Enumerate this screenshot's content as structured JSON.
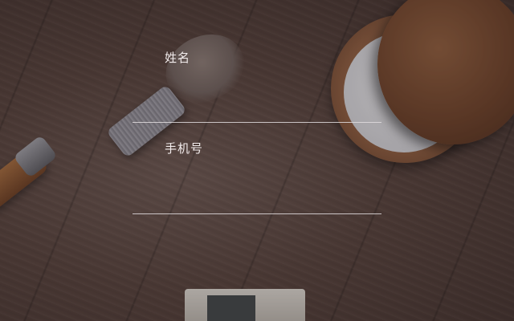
{
  "form": {
    "name": {
      "label": "姓名",
      "value": ""
    },
    "phone": {
      "label": "手机号",
      "value": ""
    }
  },
  "background": {
    "description_icon": "wooden-table-photo"
  },
  "colors": {
    "label_text": "#f2ecec",
    "underline": "#e1dcde"
  }
}
